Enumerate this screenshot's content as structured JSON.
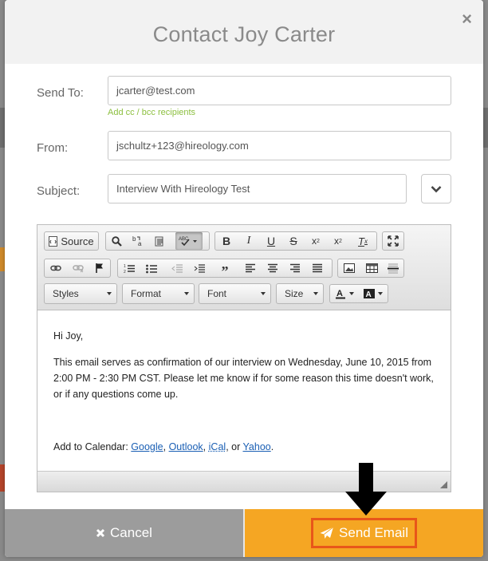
{
  "modal": {
    "title": "Contact Joy Carter",
    "close_glyph": "×",
    "close_icon": "close-icon"
  },
  "form": {
    "send_to_label": "Send To:",
    "send_to_value": "jcarter@test.com",
    "cc_link": "Add cc / bcc recipients",
    "from_label": "From:",
    "from_value": "jschultz+123@hireology.com",
    "subject_label": "Subject:",
    "subject_value": "Interview With Hireology Test",
    "template_dropdown_icon": "chevron-down-icon"
  },
  "toolbar": {
    "source_label": "Source",
    "styles_label": "Styles",
    "format_label": "Format",
    "font_label": "Font",
    "size_label": "Size",
    "spellcheck_text": "ABC",
    "icons": [
      "source-icon",
      "find-icon",
      "replace-icon",
      "paste-text-icon",
      "spellcheck-icon",
      "bold-icon",
      "italic-icon",
      "underline-icon",
      "strikethrough-icon",
      "subscript-icon",
      "superscript-icon",
      "remove-format-icon",
      "maximize-icon",
      "link-icon",
      "unlink-icon",
      "anchor-icon",
      "numbered-list-icon",
      "bulleted-list-icon",
      "outdent-icon",
      "indent-icon",
      "blockquote-icon",
      "align-left-icon",
      "align-center-icon",
      "align-right-icon",
      "justify-icon",
      "image-icon",
      "table-icon",
      "horizontal-rule-icon",
      "text-color-icon",
      "background-color-icon"
    ]
  },
  "body": {
    "greeting": "Hi Joy,",
    "paragraph": "This email serves as confirmation of our interview on Wednesday, June 10, 2015 from 2:00 PM - 2:30 PM CST. Please let me know if for some reason this time doesn't work, or if any questions come up.",
    "calendar_prefix": "Add to Calendar:",
    "links": [
      "Google",
      "Outlook",
      "iCal",
      "Yahoo"
    ],
    "sep1": ",",
    "sep2": ",",
    "sep3": ", or",
    "end": "."
  },
  "footer": {
    "cancel_label": "Cancel",
    "send_label": "Send Email"
  },
  "colors": {
    "send_bg": "#f5a623",
    "cancel_bg": "#9c9c9c",
    "highlight_border": "#e8561a",
    "cc_link": "#8cbf3f",
    "link": "#1a5fb4"
  }
}
